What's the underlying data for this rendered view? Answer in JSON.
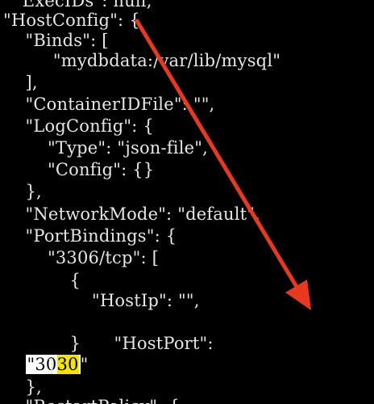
{
  "lines": [
    "  ExecIDs\": null,",
    "\"HostConfig\": {",
    "    \"Binds\": [",
    "         \"mydbdata:/var/lib/mysql\"",
    "    ],",
    "    \"ContainerIDFile\": \"\",",
    "    \"LogConfig\": {",
    "        \"Type\": \"json-file\",",
    "        \"Config\": {}",
    "    },",
    "    \"NetworkMode\": \"default\",",
    "    \"PortBindings\": {",
    "        \"3306/tcp\": [",
    "            {",
    "                \"HostIp\": \"\",",
    "                \"HostPort\":"
  ],
  "host_port": {
    "open_quote": "\"",
    "digits_plain": "30",
    "digits_selected": "30",
    "close_quote": "\""
  },
  "tail_lines": [
    "            }",
    "        ]",
    "    },",
    "    \"RestartPolicy\": {"
  ],
  "annotation": {
    "arrow_color": "#e8391e"
  }
}
